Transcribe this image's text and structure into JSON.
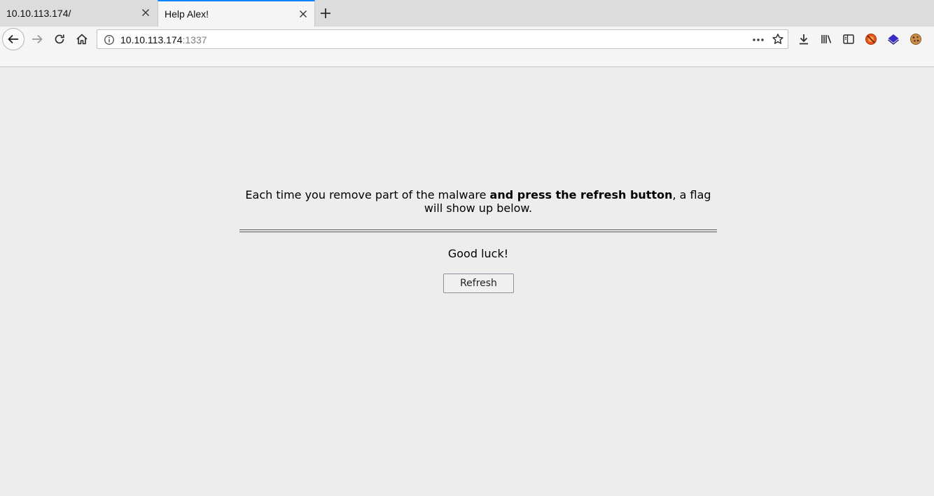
{
  "tabs": [
    {
      "title": "10.10.113.174/",
      "active": false
    },
    {
      "title": "Help Alex!",
      "active": true
    }
  ],
  "urlbar": {
    "host": "10.10.113.174",
    "port": ":1337"
  },
  "toolbar_icons": [
    "download-icon",
    "library-icon",
    "reader-icon",
    "extension-red-icon",
    "extension-layers-icon",
    "cookie-icon"
  ],
  "page": {
    "text_before": "Each time you remove part of the malware ",
    "text_bold": "and press the refresh button",
    "text_after": ", a flag will show up below.",
    "good_luck": "Good luck!",
    "refresh_label": "Refresh"
  },
  "colors": {
    "active_tab_accent": "#0a84ff",
    "page_background": "#ededed"
  }
}
